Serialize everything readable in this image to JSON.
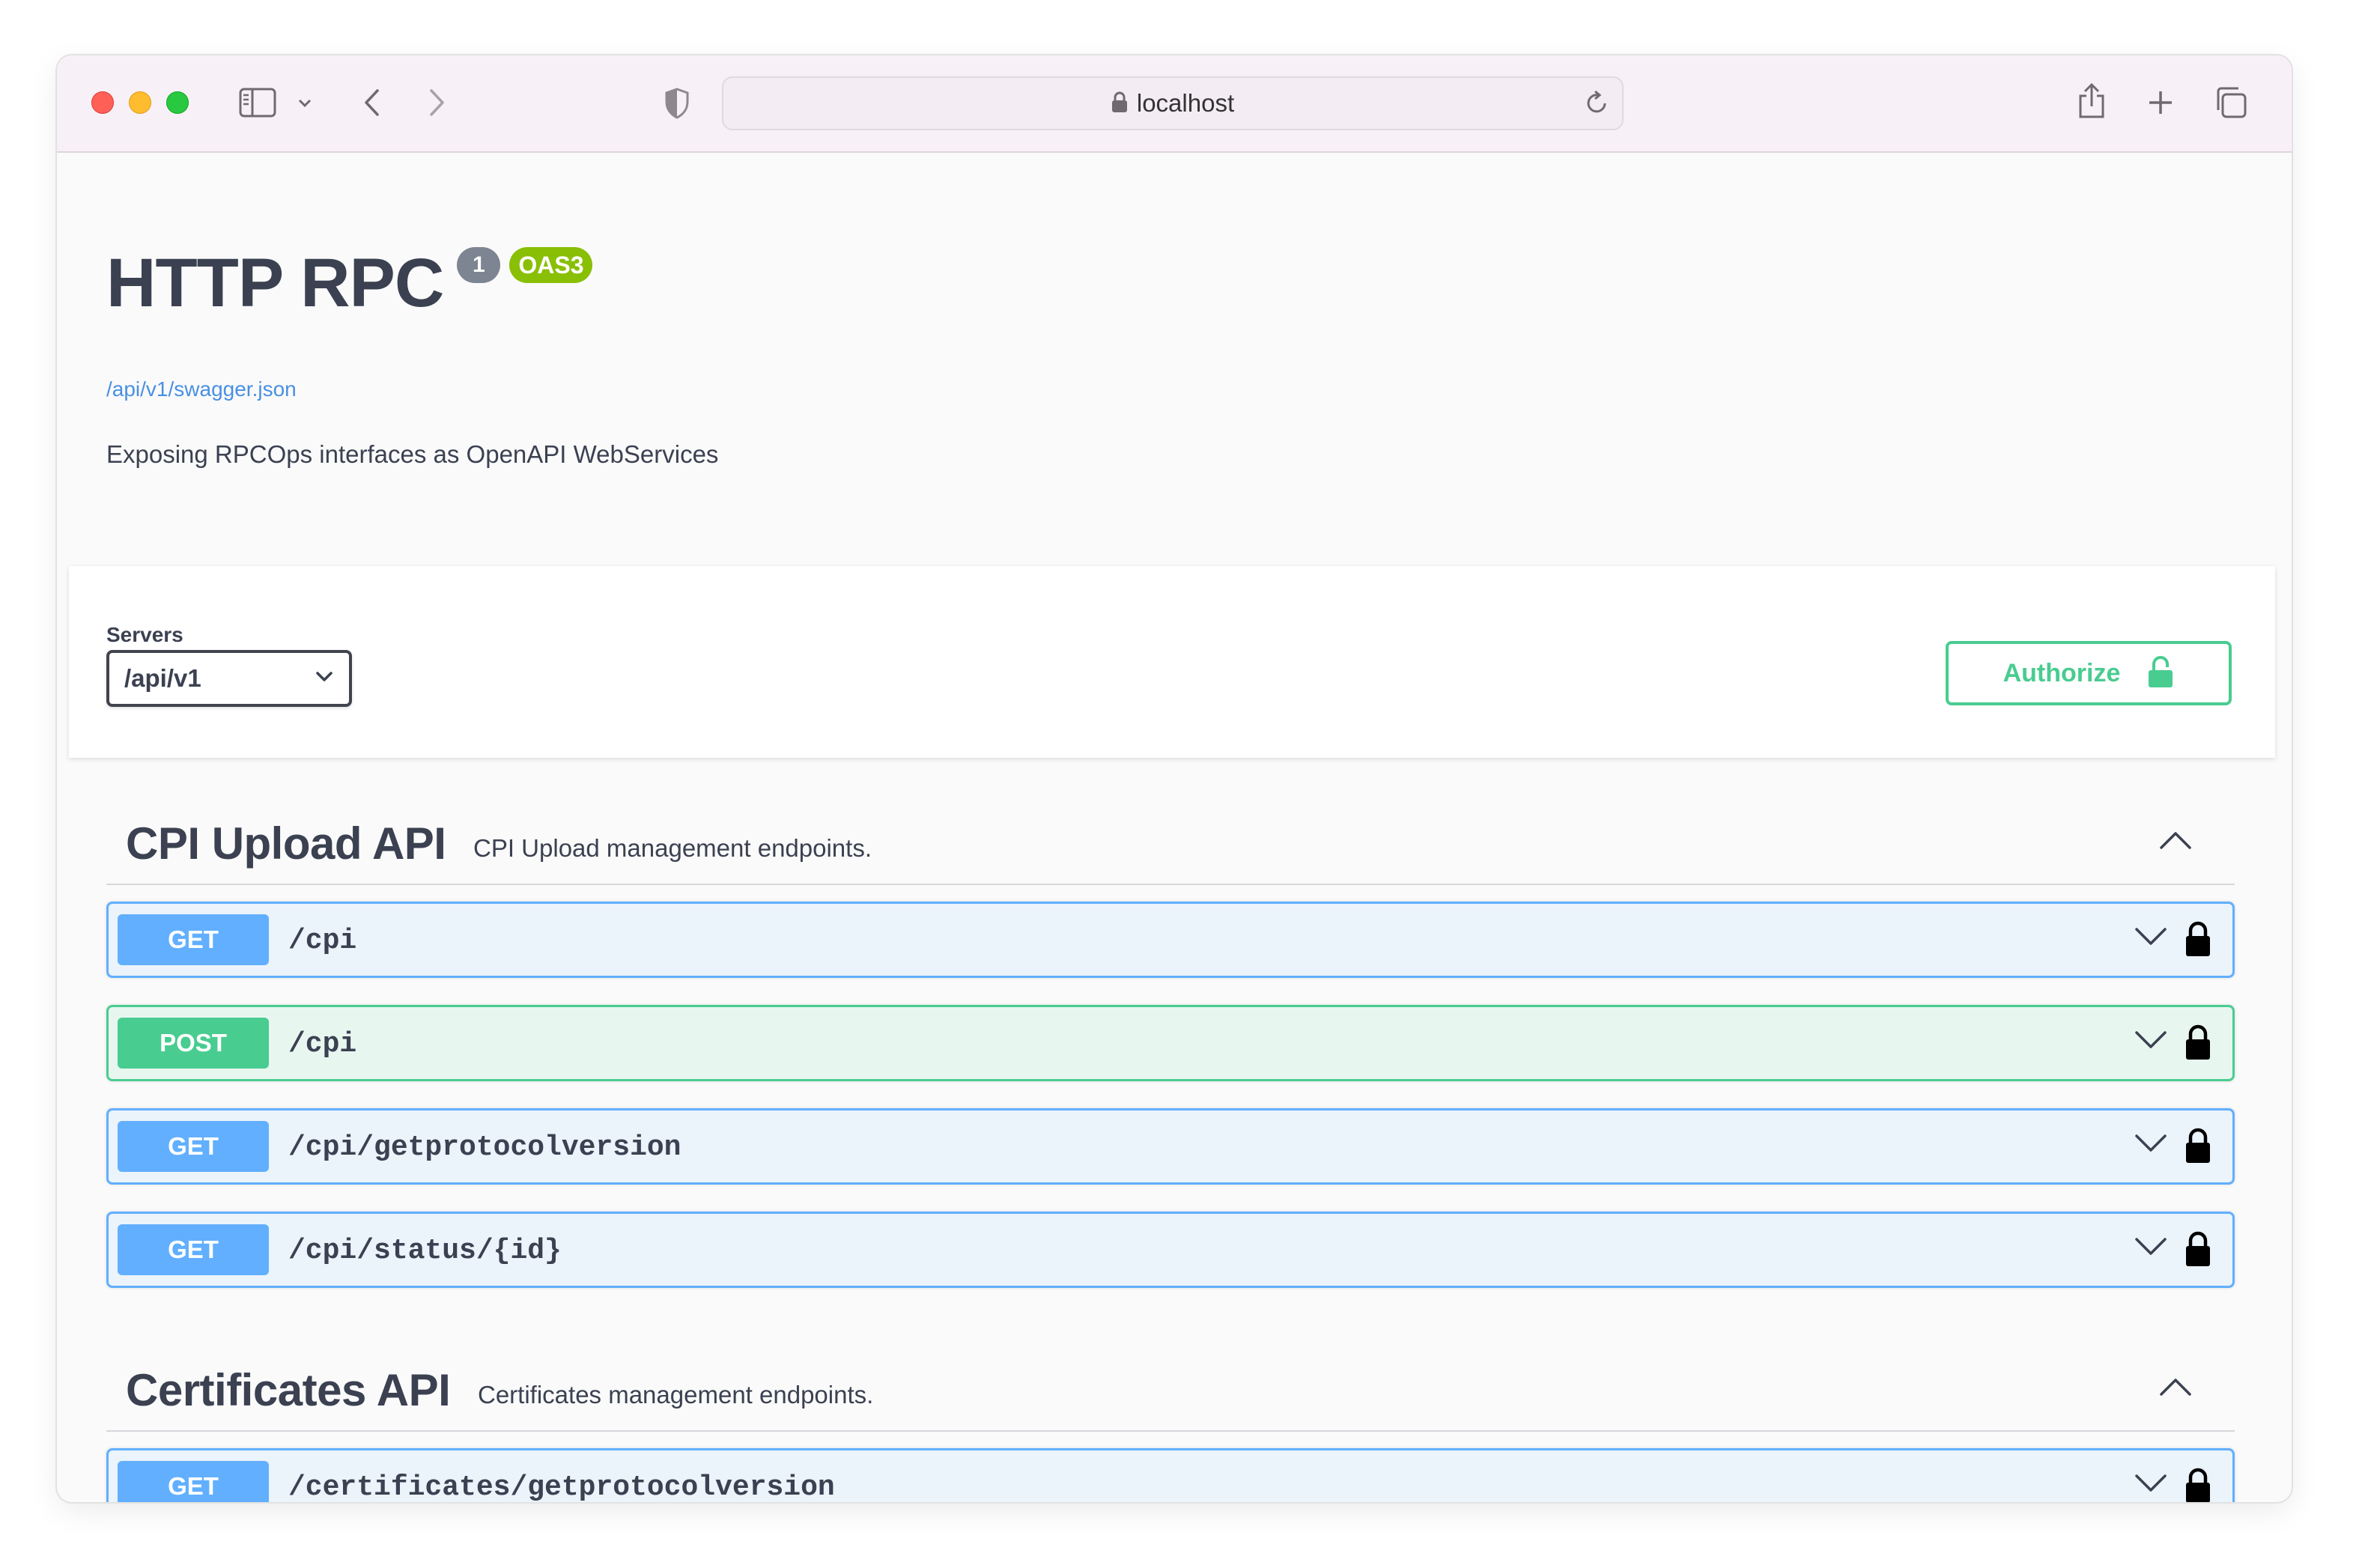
{
  "browser": {
    "url": "localhost",
    "icons": [
      "sidebar-icon",
      "chevron-down-icon",
      "back-icon",
      "forward-icon",
      "shield-icon",
      "lock-icon",
      "reload-icon",
      "share-icon",
      "new-tab-icon",
      "tabs-overview-icon"
    ]
  },
  "info": {
    "title": "HTTP RPC",
    "version": "1",
    "oas_badge": "OAS3",
    "spec_url": "/api/v1/swagger.json",
    "description": "Exposing RPCOps interfaces as OpenAPI WebServices"
  },
  "servers": {
    "label": "Servers",
    "selected": "/api/v1"
  },
  "authorize": {
    "label": "Authorize"
  },
  "tags": [
    {
      "name": "CPI Upload API",
      "description": "CPI Upload management endpoints.",
      "operations": [
        {
          "method": "GET",
          "path": "/cpi"
        },
        {
          "method": "POST",
          "path": "/cpi"
        },
        {
          "method": "GET",
          "path": "/cpi/getprotocolversion"
        },
        {
          "method": "GET",
          "path": "/cpi/status/{id}"
        }
      ]
    },
    {
      "name": "Certificates API",
      "description": "Certificates management endpoints.",
      "operations": [
        {
          "method": "GET",
          "path": "/certificates/getprotocolversion"
        }
      ]
    }
  ],
  "colors": {
    "get": "#61affe",
    "post": "#49cc90",
    "oas_badge": "#89bf04",
    "version_badge": "#7d8492",
    "link": "#4990e2",
    "text": "#3b4151"
  }
}
